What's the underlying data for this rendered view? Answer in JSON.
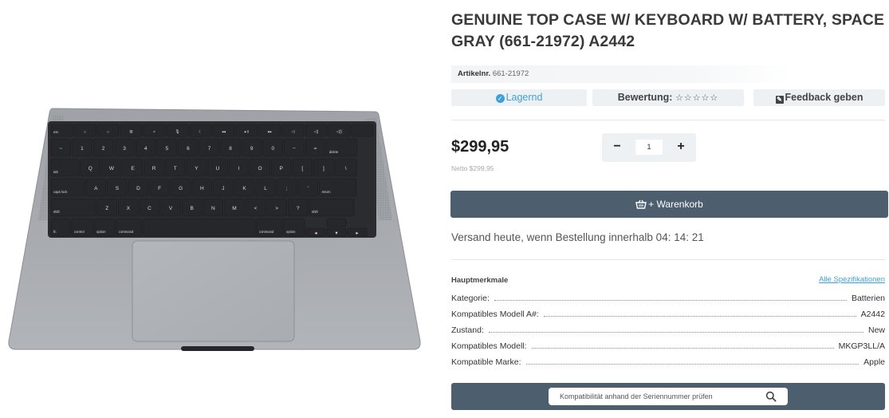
{
  "product": {
    "title": "GENUINE TOP CASE W/ KEYBOARD W/ BATTERY, SPACE GRAY (661-21972) A2442",
    "sku_label": "Artikelnr.",
    "sku_value": "661-21972"
  },
  "status": {
    "stock_label": "Lagernd",
    "rating_label": "Bewertung:",
    "rating_stars": "☆☆☆☆☆",
    "rating_value": 0,
    "feedback_label": "Feedback geben"
  },
  "pricing": {
    "price": "$299,95",
    "netto": "Netto $299,95"
  },
  "quantity": {
    "minus": "−",
    "value": "1",
    "plus": "+"
  },
  "cart": {
    "label": "+ Warenkorb"
  },
  "shipping": {
    "text": "Versand heute, wenn Bestellung innerhalb 04: 14: 21"
  },
  "features": {
    "heading": "Hauptmerkmale",
    "link": "Alle Spezifikationen",
    "rows": [
      {
        "label": "Kategorie:",
        "value": "Batterien"
      },
      {
        "label": "Kompatibles Modell A#:",
        "value": "A2442"
      },
      {
        "label": "Zustand:",
        "value": "New"
      },
      {
        "label": "Kompatibles Modell:",
        "value": "MKGP3LL/A"
      },
      {
        "label": "Kompatible Marke:",
        "value": "Apple"
      }
    ]
  },
  "serial_check": {
    "placeholder": "Kompatibilität anhand der Seriennummer prüfen"
  },
  "keyboard": {
    "fn_row": [
      "esc",
      "☼",
      "☼",
      "⊞",
      "⌕",
      "🎙",
      "☾",
      "◂◂",
      "▸॥",
      "▸▸",
      "◁",
      "◁)",
      "◁))",
      ""
    ],
    "num_row": [
      "~",
      "1",
      "2",
      "3",
      "4",
      "5",
      "6",
      "7",
      "8",
      "9",
      "0",
      "−",
      "=",
      "delete"
    ],
    "top_row": [
      "tab",
      "Q",
      "W",
      "E",
      "R",
      "T",
      "Y",
      "U",
      "I",
      "O",
      "P",
      "[",
      "]",
      "\\"
    ],
    "home_row": [
      "caps lock",
      "A",
      "S",
      "D",
      "F",
      "G",
      "H",
      "J",
      "K",
      "L",
      ";",
      "'",
      "return"
    ],
    "bottom_row": [
      "shift",
      "Z",
      "X",
      "C",
      "V",
      "B",
      "N",
      "M",
      "<",
      ">",
      "?",
      "shift"
    ],
    "mod_row": [
      "fn",
      "control",
      "option",
      "command",
      "",
      "command",
      "option",
      "◂",
      "▾",
      "▸"
    ]
  },
  "colors": {
    "accent": "#3fa0d6",
    "button_bg": "#4d5f6f",
    "pill_bg": "#eef1f4",
    "case_gray": "#a9acb1",
    "key_black": "#26272a"
  }
}
